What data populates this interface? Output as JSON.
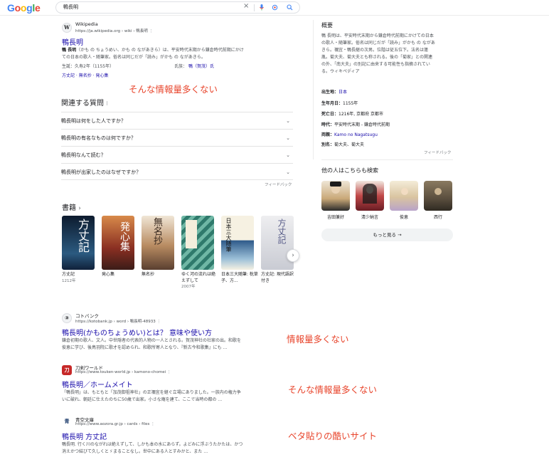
{
  "header": {
    "logo_letters": [
      {
        "ch": "G",
        "color": "#4285f4"
      },
      {
        "ch": "o",
        "color": "#ea4335"
      },
      {
        "ch": "o",
        "color": "#fbbc05"
      },
      {
        "ch": "g",
        "color": "#4285f4"
      },
      {
        "ch": "l",
        "color": "#34a853"
      },
      {
        "ch": "e",
        "color": "#ea4335"
      }
    ],
    "query": "鴨長明",
    "clear_icon": "×",
    "mic_icon": "🎤",
    "lens_icon": "◉",
    "search_icon": "⚲"
  },
  "wiki": {
    "site": "Wikipedia",
    "url": "https://ja.wikipedia.org › wiki › 鴨長明",
    "title": "鴨長明",
    "snippet_bold": "鴨 長明",
    "snippet_1": "（かも の ちょうめい、かも の ながあきら）は、平安時代末期から鎌倉時代前期にかけ",
    "snippet_2": "ての日本の歌人・随筆家。俗名は同じだが「読み」がかも の ながあきら。",
    "born_label": "生誕：",
    "born_value": "久寿2年（1155年）",
    "clan_label": "氏族：",
    "clan_value": "鴨（賀茂）氏",
    "link1": "方丈記",
    "link2": "無名抄",
    "link3": "発心集"
  },
  "annotations": {
    "a1": "そんな情報量多くない",
    "a2": "情報量多くない",
    "a3": "そんな情報量多くない",
    "a4": "ベタ貼りの酷いサイト"
  },
  "paa": {
    "title": "関連する質問",
    "items": [
      "鴨長明は何をした人ですか？",
      "鴨長明の有名なものは何ですか？",
      "鴨長明なんて読む？",
      "鴨長明が出家したのはなぜですか？"
    ],
    "feedback": "フィードバック"
  },
  "books": {
    "title": "書籍",
    "items": [
      {
        "name": "方丈記",
        "sub": "1212年",
        "color": "#1d3550"
      },
      {
        "name": "発心集",
        "sub": "",
        "color": "#a0392a"
      },
      {
        "name": "無名抄",
        "sub": "",
        "color": "#6b4a3a"
      },
      {
        "name": "ゆく河の流れは絶えずして",
        "sub": "2007年",
        "color": "#3f8b78"
      },
      {
        "name": "日本三大随筆: 枕草子、方...",
        "sub": "",
        "color": "#2e5a8a"
      },
      {
        "name": "方丈記: 現代語訳付き",
        "sub": "",
        "color": "#d8d8dc"
      }
    ]
  },
  "results": [
    {
      "site": "コトバンク",
      "url": "https://kotobank.jp › word › 鴨長明-48933",
      "title": "鴨長明(かものちょうめい)とは？ 意味や使い方",
      "snippet_1": "鎌倉初期の歌人、文人。中世隠者の代表的人物の一人とされる。賀茂神社の社家の出。和歌を",
      "snippet_2": "俊恵に学び、後鳥羽院に歌才を認められ、和歌所寄人となり、『新古今和歌集』にも …",
      "fav": "コ"
    },
    {
      "site": "刀剣ワールド",
      "url": "https://www.touken-world.jp › kamono-chomei",
      "title": "鴨長明／ホームメイト",
      "snippet_1": "「鴨長明」は、もともと「加茂御祖神社」の正禰宜を継ぐ立場にありました。一族内の権力争",
      "snippet_2": "いに破れ、朝廷に仕えたのちに50歳で出家。小さな庵を建て、ここで当時の都の …",
      "fav": "刀"
    },
    {
      "site": "青空文庫",
      "url": "https://www.aozora.gr.jp › cards › files",
      "title": "鴨長明 方丈記",
      "snippet_1": "鴨長明. 行く川のながれは絶えずして、しかも本の水にあらず。よどみに浮ぶうたかたは、かつ",
      "snippet_2": "消えかつ結びて久しくとゞまることなし。世中にある人とすみかと、また …",
      "fav": "青"
    }
  ],
  "kp": {
    "title": "概要",
    "desc_1": "鴨 長明は、平安時代末期から鎌倉時代前期にかけての日本",
    "desc_2": "の歌人・随筆家。俗名は同じだが「読み」がかも の ながあ",
    "desc_3": "きら。禰宜・鴨長継の次男。位階は従五位下。法名は蓮",
    "desc_4": "胤。菊大夫、菊大夫とも称される。後の「菊家」との関連",
    "desc_5": "の外、「南大夫」の別記に由来する可能性も指摘されてい",
    "desc_6": "る。ウィキペディア",
    "facts": [
      {
        "label": "出生地：",
        "value": "日本",
        "link": true
      },
      {
        "label": "生年月日：",
        "value": "1155年",
        "link": false
      },
      {
        "label": "死亡日：",
        "value": "1216年, 京都府 京都市",
        "link": false
      },
      {
        "label": "時代：",
        "value": "平安時代末期 - 鎌倉時代前期",
        "link": false
      },
      {
        "label": "両親：",
        "value": "Kamo no Nagatsugu",
        "link": true
      },
      {
        "label": "別名：",
        "value": "菊大夫、菊大夫",
        "link": false
      }
    ],
    "feedback": "フィードバック",
    "others_title": "他の人はこちらも検索",
    "people": [
      {
        "name": "吉田兼好",
        "color": "#c9a878"
      },
      {
        "name": "清少納言",
        "color": "#a43a3a"
      },
      {
        "name": "俊恵",
        "color": "#d9c4a0"
      },
      {
        "name": "西行",
        "color": "#5a4e3e"
      }
    ],
    "more_button": "もっと見る"
  }
}
